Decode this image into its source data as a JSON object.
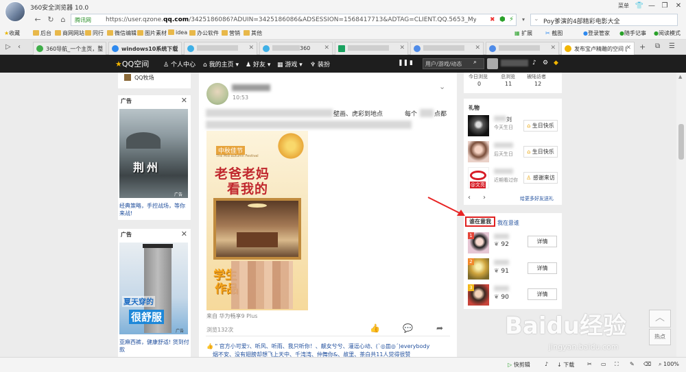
{
  "browser": {
    "title": "360安全浏览器 10.0",
    "menu_label": "菜单",
    "url_site": "腾讯网",
    "url_prefix": "https://user.qzone.",
    "url_domain": "qq.com",
    "url_rest": "/3425186086?ADUIN=3425186086&ADSESSION=1568417713&ADTAG=CLIENT.QQ.5653_MyTip.0&ADPUI",
    "search_text": "Poy爹演的4部精彩电影大全"
  },
  "bookmarks": [
    "收藏",
    "后台",
    "商网网站",
    "同行",
    "微信编辑",
    "图片素材",
    "idea",
    "办公软件",
    "营销",
    "其他"
  ],
  "bookmarks_right": [
    "扩展",
    "截图",
    "登录管家",
    "随手记事",
    "阅读模式"
  ],
  "tabs": [
    {
      "label": "360导航_一个主页，整",
      "color": "#3fae49"
    },
    {
      "label": "windows10系统下载",
      "color": "#2d89ef"
    },
    {
      "label": "",
      "color": "#3fb0e6"
    },
    {
      "label": "360",
      "color": "#3fb0e6"
    },
    {
      "label": "",
      "color": "#1aa260"
    },
    {
      "label": "",
      "color": "#4f8be8"
    },
    {
      "label": "",
      "color": "#4f8be8"
    },
    {
      "label": "发布宝卢精雕的空间 [",
      "color": "#f2b500"
    }
  ],
  "qzone_nav": {
    "logo": "QQ空间",
    "items": [
      "个人中心",
      "我的主页",
      "好友",
      "游戏",
      "装扮"
    ],
    "search_placeholder": "用户/游戏/动态"
  },
  "left": {
    "farm": "QQ牧场",
    "ad1_label": "广告",
    "ad1_caption": "经典策略，手控战场，等你来战!",
    "ad1_banner": "荆州",
    "ad1_tag": "广告",
    "ad2_label": "广告",
    "ad2_caption": "亚麻西裤，健康舒适! 货到付款",
    "ad2_line1": "夏天穿的",
    "ad2_line2": "很舒服",
    "ad2_tag": "广告"
  },
  "post": {
    "time": "10:53",
    "text_visible_1": "壁画、虎彩到地点",
    "text_visible_2": "每个",
    "text_visible_3": "点都",
    "image_top_text": "中秋佳节",
    "image_sub_text": "The Mid-autumn Festival",
    "image_headline_1": "老爸老妈",
    "image_headline_2": "看我的",
    "image_bottom_1": "学生",
    "image_bottom_2": "作品",
    "device": "来自 华为畅享9 Plus",
    "views": "浏览132次",
    "comment": "\" 官方小可爱ｿ、听风、听雨、我只听你！、靓女兮兮、灌逗心动、(`◎皿◎´)everybody",
    "comment_line2": "烟不安、没有翅膀却想飞上天中、千湾湾、仲舞你&、故里、茶白共11人觉得很赞"
  },
  "right": {
    "stats": [
      {
        "label": "今日浏览",
        "value": "0"
      },
      {
        "label": "总浏览",
        "value": "11"
      },
      {
        "label": "被陆访者",
        "value": "12"
      }
    ],
    "gift_title": "礼物",
    "gifts": [
      {
        "name": "刘",
        "note": "今天生日",
        "btn": "生日快乐"
      },
      {
        "name": "",
        "note": "后天生日",
        "btn": "生日快乐"
      },
      {
        "name": "",
        "note": "近期看过你",
        "btn": "感谢来访"
      }
    ],
    "wen_label": "@文亮",
    "more_gifts": "给更多好友送礼",
    "tab_active": "谁在意我",
    "tab_other": "我在意谁",
    "carers": [
      {
        "rank": "1",
        "score": "92",
        "btn": "详情",
        "rank_color": "#e5473b"
      },
      {
        "rank": "2",
        "score": "91",
        "btn": "详情",
        "rank_color": "#f2892b"
      },
      {
        "rank": "3",
        "score": "90",
        "btn": "详情",
        "rank_color": "#f2b71b"
      }
    ]
  },
  "sidebar_widget": {
    "label": "热点"
  },
  "statusbar": [
    "快剪辑",
    "下载",
    "100%"
  ],
  "watermark": "Baidu经验",
  "watermark_url": "jingyan.baidu.com"
}
